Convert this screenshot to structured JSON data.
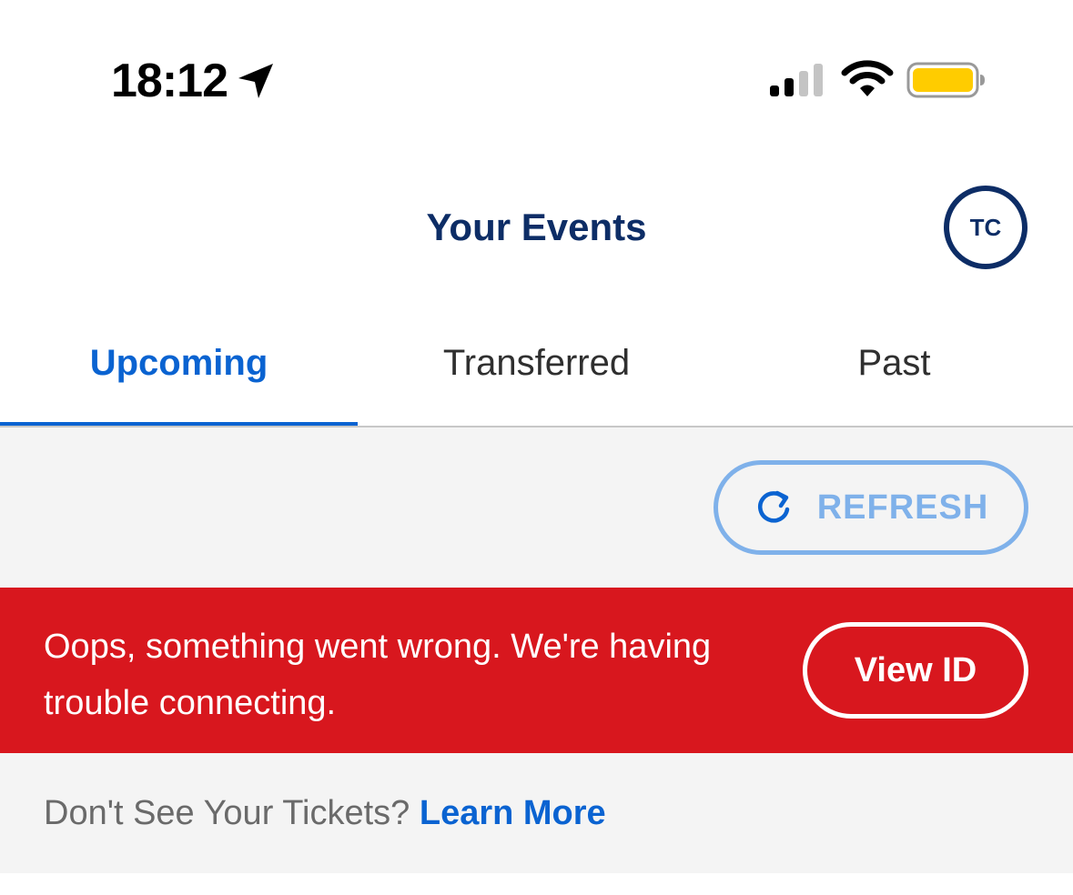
{
  "status_bar": {
    "time": "18:12",
    "icons": [
      "location-arrow-icon",
      "cellular-signal-icon",
      "wifi-icon",
      "battery-icon"
    ],
    "battery_color": "#ffcc00"
  },
  "header": {
    "title": "Your Events",
    "avatar_initials": "TC"
  },
  "tabs": [
    {
      "label": "Upcoming",
      "active": true
    },
    {
      "label": "Transferred",
      "active": false
    },
    {
      "label": "Past",
      "active": false
    }
  ],
  "refresh": {
    "label": "REFRESH",
    "icon": "refresh-icon"
  },
  "error_banner": {
    "message": "Oops, something went wrong. We're having trouble connecting.",
    "button_label": "View ID"
  },
  "help": {
    "question": "Don't See Your Tickets?",
    "link_label": "Learn More"
  },
  "colors": {
    "brand_navy": "#0d2d66",
    "accent_blue": "#0a63d1",
    "error_red": "#d8171e",
    "refresh_blue": "#7fb1ea",
    "background_gray": "#f4f4f4"
  }
}
